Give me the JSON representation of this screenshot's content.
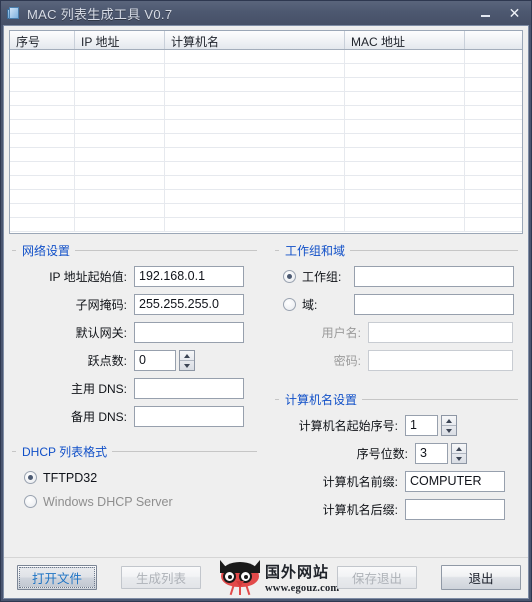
{
  "window": {
    "title": "MAC 列表生成工具 V0.7",
    "app_icon": "document-stack-icon",
    "minimize_label": "–",
    "close_label": "✕",
    "titlebar_color": "#4d5870",
    "accent_color": "#1150c8"
  },
  "list": {
    "columns": [
      "序号",
      "IP 地址",
      "计算机名",
      "MAC 地址",
      ""
    ],
    "rows": []
  },
  "network": {
    "title": "网络设置",
    "ip_start_label": "IP 地址起始值:",
    "ip_start_value": "192.168.0.1",
    "subnet_label": "子网掩码:",
    "subnet_value": "255.255.255.0",
    "gateway_label": "默认网关:",
    "gateway_value": "",
    "hops_label": "跃点数:",
    "hops_value": "0",
    "dns_primary_label": "主用 DNS:",
    "dns_primary_value": "",
    "dns_backup_label": "备用 DNS:",
    "dns_backup_value": ""
  },
  "dhcp": {
    "title": "DHCP 列表格式",
    "options": [
      {
        "label": "TFTPD32",
        "checked": true
      },
      {
        "label": "Windows DHCP Server",
        "checked": false
      }
    ]
  },
  "workgroup": {
    "title": "工作组和域",
    "workgroup_label": "工作组:",
    "workgroup_checked": true,
    "workgroup_value": "",
    "domain_label": "域:",
    "domain_checked": false,
    "domain_value": "",
    "username_label": "用户名:",
    "username_value": "",
    "password_label": "密码:",
    "password_value": ""
  },
  "computer": {
    "title": "计算机名设置",
    "start_index_label": "计算机名起始序号:",
    "start_index_value": "1",
    "digits_label": "序号位数:",
    "digits_value": "3",
    "prefix_label": "计算机名前缀:",
    "prefix_value": "COMPUTER",
    "suffix_label": "计算机名后缀:",
    "suffix_value": ""
  },
  "buttons": {
    "open_file": "打开文件",
    "generate_list": "生成列表",
    "save_exit": "保存退出",
    "exit": "退出"
  },
  "watermark": {
    "name": "国外网站",
    "url": "www.egouz.com",
    "logo": "owl-logo"
  }
}
